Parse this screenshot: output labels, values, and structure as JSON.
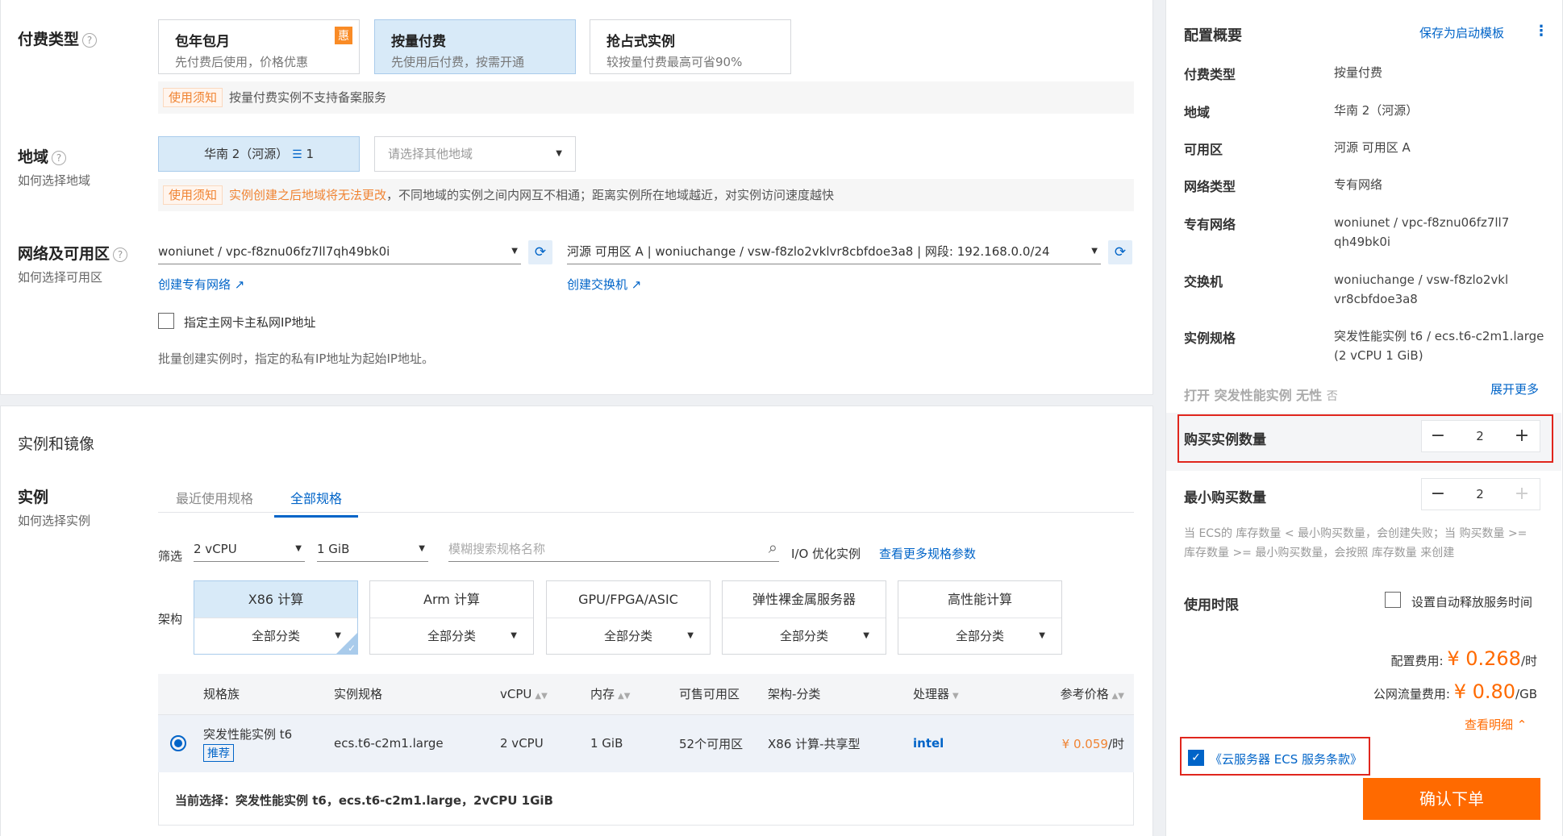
{
  "billing": {
    "title": "付费类型",
    "options": [
      {
        "title": "包年包月",
        "sub": "先付费后使用，价格优惠",
        "badge": "惠"
      },
      {
        "title": "按量付费",
        "sub": "先使用后付费，按需开通"
      },
      {
        "title": "抢占式实例",
        "sub": "较按量付费最高可省90%"
      }
    ],
    "notice_tag": "使用须知",
    "notice_text": "按量付费实例不支持备案服务"
  },
  "region": {
    "title": "地域",
    "help_link": "如何选择地域",
    "selected": "华南 2（河源）",
    "selected_count": "1",
    "other_placeholder": "请选择其他地域",
    "notice_tag": "使用须知",
    "notice_warn": "实例创建之后地域将无法更改",
    "notice_text": "，不同地域的实例之间内网互不相通；距离实例所在地域越近，对实例访问速度越快"
  },
  "network": {
    "title": "网络及可用区",
    "help_link": "如何选择可用区",
    "vpc_value": "woniunet / vpc-f8znu06fz7ll7qh49bk0i",
    "vswitch_value": "河源 可用区 A | woniuchange / vsw-f8zlo2vklvr8cbfdoe3a8 | 网段: 192.168.0.0/24",
    "create_vpc": "创建专有网络",
    "create_vswitch": "创建交换机",
    "specify_ip_label": "指定主网卡主私网IP地址",
    "ip_hint": "批量创建实例时，指定的私有IP地址为起始IP地址。"
  },
  "instance_section": {
    "title": "实例和镜像",
    "instance_label": "实例",
    "help_link": "如何选择实例",
    "tabs": [
      "最近使用规格",
      "全部规格"
    ],
    "filter_label": "筛选",
    "vcpu_filter": "2 vCPU",
    "mem_filter": "1 GiB",
    "search_placeholder": "模糊搜索规格名称",
    "io_label": "I/O 优化实例",
    "more_params": "查看更多规格参数",
    "arch_label": "架构",
    "archs": [
      {
        "name": "X86 计算",
        "sub": "全部分类"
      },
      {
        "name": "Arm 计算",
        "sub": "全部分类"
      },
      {
        "name": "GPU/FPGA/ASIC",
        "sub": "全部分类"
      },
      {
        "name": "弹性裸金属服务器",
        "sub": "全部分类"
      },
      {
        "name": "高性能计算",
        "sub": "全部分类"
      }
    ],
    "table": {
      "headers": [
        "规格族",
        "实例规格",
        "vCPU",
        "内存",
        "可售可用区",
        "架构-分类",
        "处理器",
        "参考价格"
      ],
      "rows": [
        {
          "family": "突发性能实例 t6",
          "badge": "推荐",
          "spec": "ecs.t6-c2m1.large",
          "vcpu": "2 vCPU",
          "mem": "1 GiB",
          "zones": "52个可用区",
          "arch": "X86 计算-共享型",
          "cpu": "intel",
          "price_symbol": "¥",
          "price": "0.059",
          "price_unit": "/时"
        }
      ]
    },
    "current_selection": "当前选择：突发性能实例 t6，ecs.t6-c2m1.large，2vCPU 1GiB"
  },
  "summary": {
    "title": "配置概要",
    "save_template": "保存为启动模板",
    "rows": [
      {
        "label": "付费类型",
        "value": "按量付费"
      },
      {
        "label": "地域",
        "value": "华南 2（河源）"
      },
      {
        "label": "可用区",
        "value": "河源 可用区 A"
      },
      {
        "label": "网络类型",
        "value": "专有网络"
      },
      {
        "label": "专有网络",
        "value": "woniunet / vpc-f8znu06fz7ll7qh49bk0i"
      },
      {
        "label": "交换机",
        "value": "woniuchange / vsw-f8zlo2vklvr8cbfdoe3a8"
      },
      {
        "label": "实例规格",
        "value": "突发性能实例 t6 / ecs.t6-c2m1.large (2 vCPU 1 GiB)"
      }
    ],
    "burst_label": "打开 突发性能实例 无性",
    "burst_value": "否",
    "expand_more": "展开更多",
    "buy_count_label": "购买实例数量",
    "buy_count": "2",
    "min_count_label": "最小购买数量",
    "min_count": "2",
    "min_hint": "当 ECS的 库存数量 < 最小购买数量，会创建失败；当 购买数量 >= 库存数量 >= 最小购买数量，会按照 库存数量 来创建",
    "duration_label": "使用时限",
    "auto_release_label": "设置自动释放服务时间",
    "config_fee_label": "配置费用:",
    "config_fee": "¥ 0.268",
    "config_fee_unit": "/时",
    "traffic_fee_label": "公网流量费用:",
    "traffic_fee": "¥ 0.80",
    "traffic_fee_unit": "/GB",
    "view_detail": "查看明细",
    "terms": "《云服务器 ECS 服务条款》",
    "order_button": "确认下单",
    "more_icon": "⋮"
  },
  "colors": {
    "primary": "#0064c8",
    "orange": "#ff6a00",
    "red_box": "#e0261d"
  }
}
